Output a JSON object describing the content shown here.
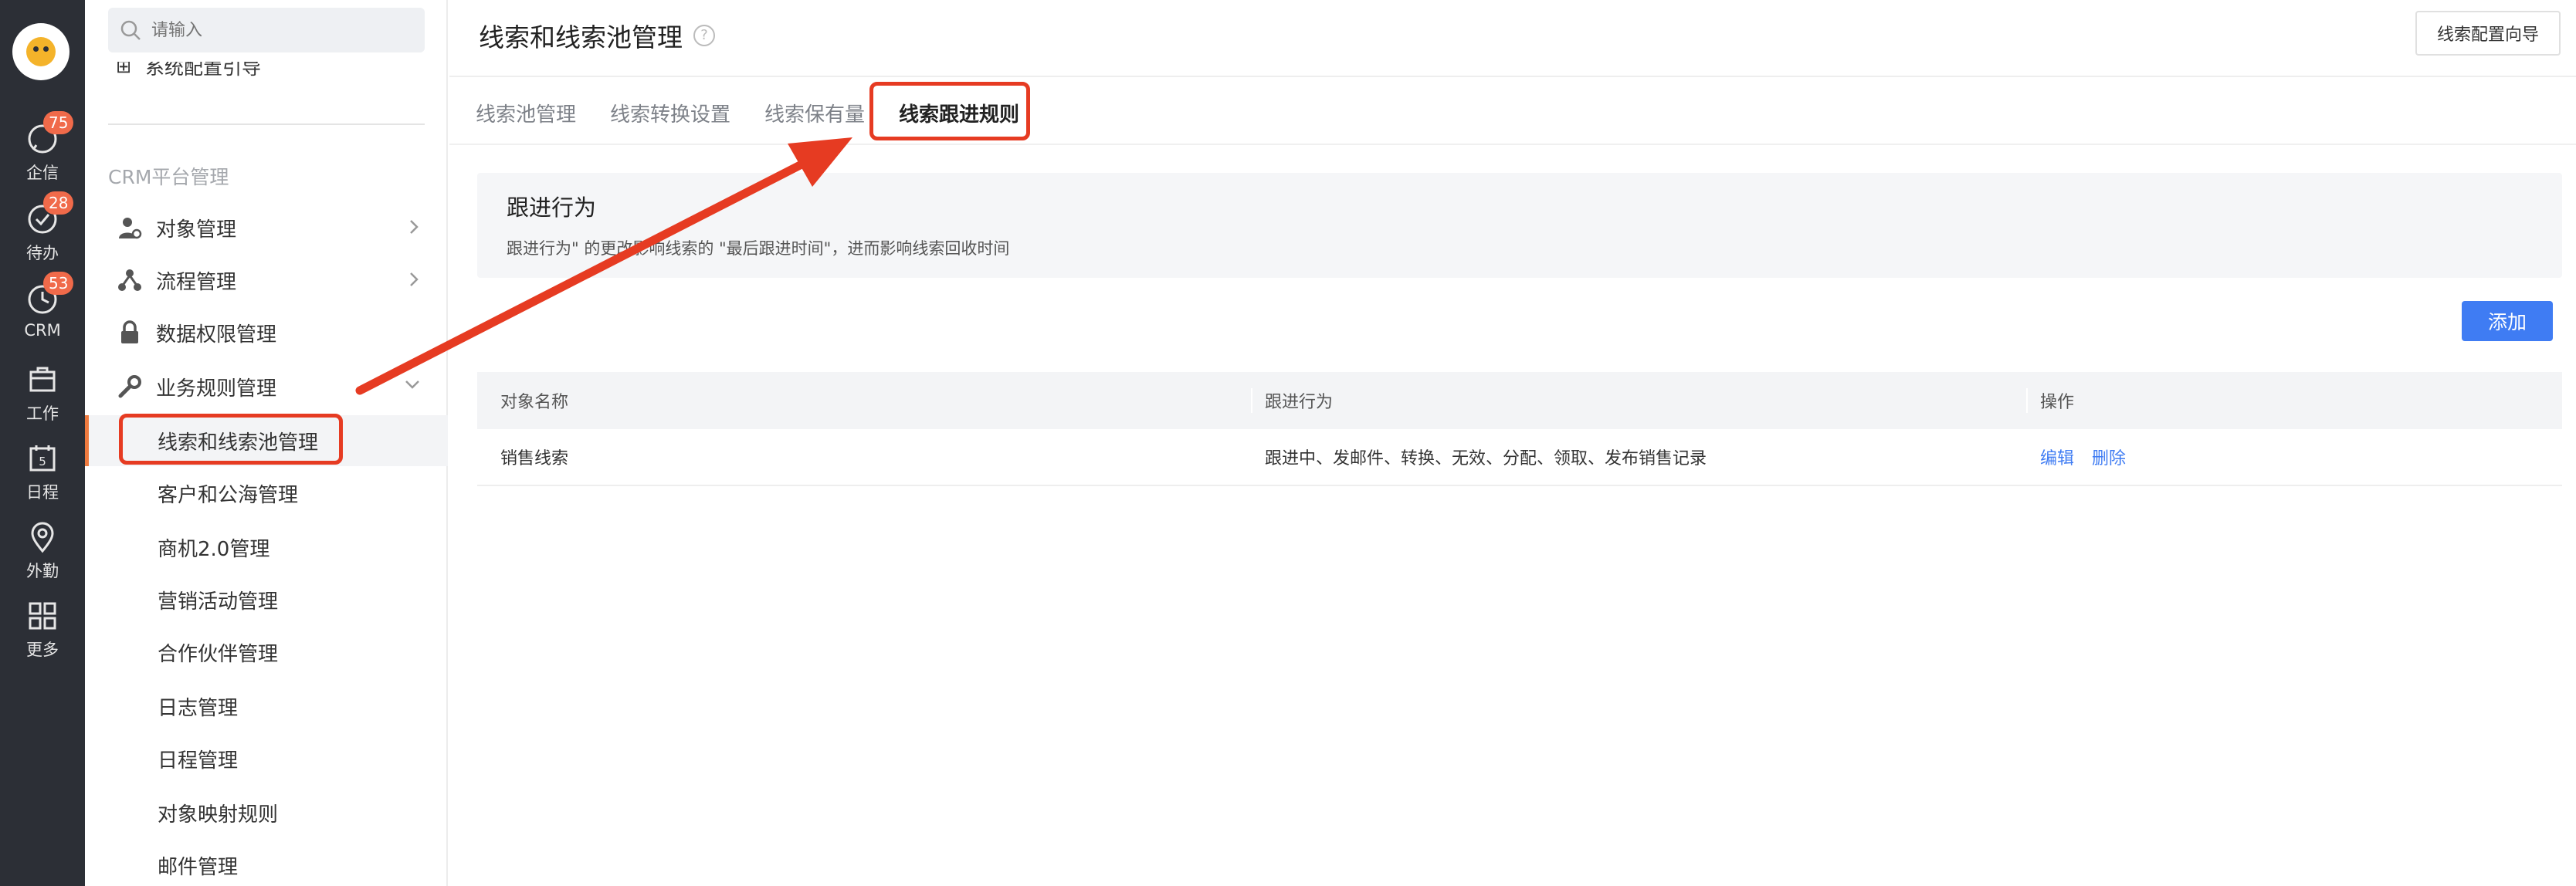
{
  "rail": {
    "items": [
      {
        "label": "企信",
        "badge": "75"
      },
      {
        "label": "待办",
        "badge": "28"
      },
      {
        "label": "CRM",
        "badge": "53"
      },
      {
        "label": "工作",
        "badge": ""
      },
      {
        "label": "日程",
        "badge": ""
      },
      {
        "label": "外勤",
        "badge": ""
      },
      {
        "label": "更多",
        "badge": ""
      }
    ],
    "calendar_day": "5"
  },
  "sidebar": {
    "search_placeholder": "请输入",
    "guide_item": "系统配置引导",
    "section_title": "CRM平台管理",
    "items": [
      {
        "label": "对象管理"
      },
      {
        "label": "流程管理"
      },
      {
        "label": "数据权限管理"
      },
      {
        "label": "业务规则管理"
      }
    ],
    "sub_items": [
      {
        "label": "线索和线索池管理"
      },
      {
        "label": "客户和公海管理"
      },
      {
        "label": "商机2.0管理"
      },
      {
        "label": "营销活动管理"
      },
      {
        "label": "合作伙伴管理"
      },
      {
        "label": "日志管理"
      },
      {
        "label": "日程管理"
      },
      {
        "label": "对象映射规则"
      },
      {
        "label": "邮件管理"
      }
    ]
  },
  "header": {
    "title": "线索和线索池管理",
    "help": "?",
    "guide_button": "线索配置向导"
  },
  "tabs": [
    {
      "label": "线索池管理"
    },
    {
      "label": "线索转换设置"
    },
    {
      "label": "线索保有量"
    },
    {
      "label": "线索跟进规则"
    }
  ],
  "info": {
    "title": "跟进行为",
    "desc_pre": "跟进行为\" 的更改",
    "desc_post": "影响线索的 \"最后跟进时间\"，进而影响线索回收时间"
  },
  "add_button": "添加",
  "table": {
    "headers": [
      "对象名称",
      "跟进行为",
      "操作"
    ],
    "rows": [
      {
        "name": "销售线索",
        "behavior": "跟进中、发邮件、转换、无效、分配、领取、发布销售记录",
        "edit": "编辑",
        "delete": "删除"
      }
    ]
  },
  "colors": {
    "rail_bg": "#2c2f36",
    "accent_blue": "#3f7cf3",
    "annotation_red": "#e63b22",
    "badge_red": "#f06a4a"
  }
}
